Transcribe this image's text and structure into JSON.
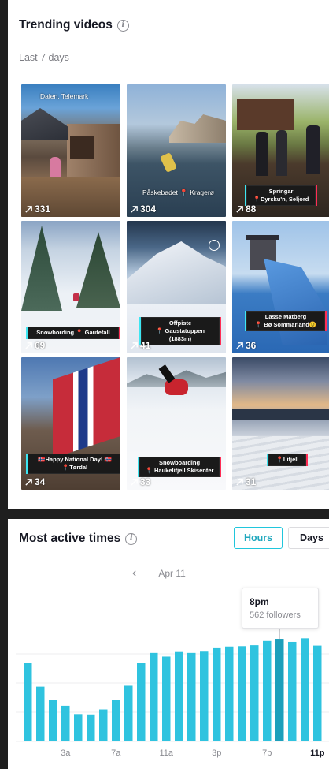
{
  "trending": {
    "title": "Trending videos",
    "period": "Last 7 days",
    "videos": [
      {
        "views": "331",
        "location": "Dalen, Telemark",
        "caption": ""
      },
      {
        "views": "304",
        "location": "Påskebadet 📍 Kragerø",
        "caption": ""
      },
      {
        "views": "88",
        "location": "",
        "caption": "Springar\n📍Dyrsku'n, Seljord"
      },
      {
        "views": "69",
        "location": "",
        "caption": "Snowbording 📍 Gautefall"
      },
      {
        "views": "41",
        "location": "",
        "caption": "Offpiste\n📍 Gaustatoppen (1883m)"
      },
      {
        "views": "36",
        "location": "",
        "caption": "Lasse Matberg\n📍 Bø Sommarland😉"
      },
      {
        "views": "34",
        "location": "",
        "caption": "🇳🇴Happy National Day! 🇳🇴\n📍Tørdal"
      },
      {
        "views": "33",
        "location": "",
        "caption": "Snowboarding\n📍 Haukelifjell Skisenter"
      },
      {
        "views": "31",
        "location": "",
        "caption": "📍Lifjell"
      }
    ]
  },
  "active": {
    "title": "Most active times",
    "hours_label": "Hours",
    "days_label": "Days",
    "date": "Apr 11",
    "tooltip_time": "8pm",
    "tooltip_followers": "562 followers",
    "bar_color": "#2fc3df",
    "highlight_color": "#1c9fbb"
  },
  "chart_data": {
    "type": "bar",
    "title": "",
    "xlabel": "",
    "ylabel": "",
    "categories": [
      "12a",
      "1a",
      "2a",
      "3a",
      "4a",
      "5a",
      "6a",
      "7a",
      "8a",
      "9a",
      "10a",
      "11a",
      "12p",
      "1p",
      "2p",
      "3p",
      "4p",
      "5p",
      "6p",
      "7p",
      "8p",
      "9p",
      "10p",
      "11p"
    ],
    "tick_labels": [
      "3a",
      "7a",
      "11a",
      "3p",
      "7p",
      "11p"
    ],
    "tick_indices": [
      3,
      7,
      11,
      15,
      19,
      23
    ],
    "bold_tick": "11p",
    "values": [
      430,
      300,
      225,
      195,
      150,
      148,
      175,
      225,
      305,
      430,
      485,
      465,
      490,
      485,
      492,
      515,
      520,
      522,
      527,
      550,
      562,
      545,
      565,
      525
    ],
    "highlight_index": 20,
    "ylim": [
      0,
      640
    ]
  }
}
